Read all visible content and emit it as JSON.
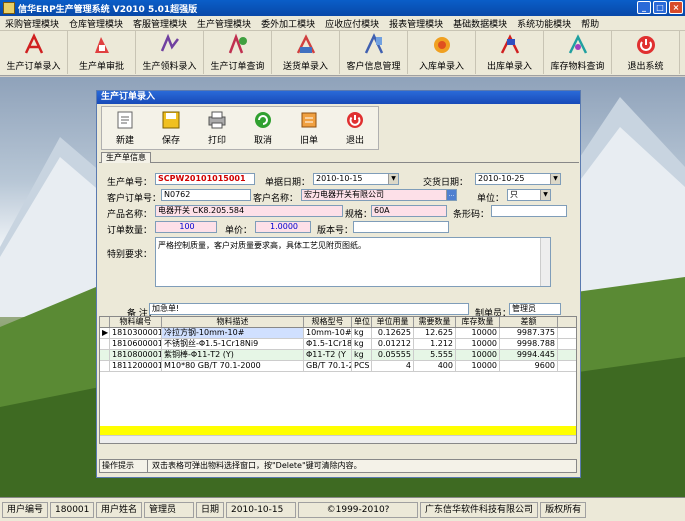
{
  "titlebar": {
    "title": "信华ERP生产管理系统  V2010 5.01超强版"
  },
  "menu": [
    "采购管理模块",
    "仓库管理模块",
    "客服管理模块",
    "生产管理模块",
    "委外加工模块",
    "应收应付模块",
    "报表管理模块",
    "基础数据模块",
    "系统功能模块",
    "帮助"
  ],
  "toolbar": [
    {
      "label": "生产订单录入",
      "icon": "adobe-red-icon"
    },
    {
      "label": "生产单审批",
      "icon": "red-doc-icon"
    },
    {
      "label": "生产领料录入",
      "icon": "material-icon"
    },
    {
      "label": "生产订单查询",
      "icon": "query-icon"
    },
    {
      "label": "送货单录入",
      "icon": "delivery-icon"
    },
    {
      "label": "客户信息管理",
      "icon": "customer-icon"
    },
    {
      "label": "入库单录入",
      "icon": "stock-in-icon"
    },
    {
      "label": "出库单录入",
      "icon": "stock-out-icon"
    },
    {
      "label": "库存物料查询",
      "icon": "inventory-icon"
    },
    {
      "label": "退出系统",
      "icon": "exit-icon"
    }
  ],
  "form": {
    "title": "生产订单录入",
    "tools": [
      {
        "label": "新建",
        "icon": "new-icon"
      },
      {
        "label": "保存",
        "icon": "save-icon"
      },
      {
        "label": "打印",
        "icon": "print-icon"
      },
      {
        "label": "取消",
        "icon": "cancel-icon"
      },
      {
        "label": "旧单",
        "icon": "old-order-icon"
      },
      {
        "label": "退出",
        "icon": "exit-icon"
      }
    ],
    "tab": "生产单信息",
    "labels": {
      "order_no": "生产单号：",
      "doc_date": "单据日期：",
      "delivery_date": "交货日期：",
      "cust_order": "客户订单号：",
      "cust_name": "客户名称：",
      "unit": "单位：",
      "product": "产品名称：",
      "spec": "规格：",
      "barcode": "条形码：",
      "qty": "订单数量：",
      "price": "单价：",
      "version": "版本号：",
      "requirement": "特别要求：",
      "note": "备 注：",
      "maker": "制单员："
    },
    "values": {
      "order_no": "SCPW20101015001",
      "doc_date": "2010-10-15",
      "delivery_date": "2010-10-25",
      "cust_order": "N0762",
      "cust_name": "宏力电器开关有限公司",
      "unit": "只",
      "product": "电器开关 CK8.205.584",
      "spec": "60A",
      "barcode": "",
      "qty": "100",
      "price": "1.0000",
      "version": "",
      "requirement": "严格控制质量，客户对质量要求高，具体工艺见附页图纸。",
      "note": "加急单!",
      "maker": "管理员"
    },
    "grid": {
      "headers": [
        "物料编号",
        "物料描述",
        "规格型号",
        "单位",
        "单位用量",
        "需要数量",
        "库存数量",
        "差额"
      ],
      "rows": [
        [
          "1810300001",
          "冷拉方钢-10mm-10#",
          "10mm-10#",
          "kg",
          "0.12625",
          "12.625",
          "10000",
          "9987.375"
        ],
        [
          "1810600001",
          "不锈钢丝-Φ1.5-1Cr18Ni9",
          "Φ1.5-1Cr18",
          "kg",
          "0.01212",
          "1.212",
          "10000",
          "9998.788"
        ],
        [
          "1810800001",
          "紫铜棒-Φ11-T2 (Y)",
          "Φ11-T2 (Y",
          "kg",
          "0.05555",
          "5.555",
          "10000",
          "9994.445"
        ],
        [
          "1811200001",
          "M10*80 GB/T 70.1-2000",
          "GB/T 70.1-2",
          "PCS",
          "4",
          "400",
          "10000",
          "9600"
        ]
      ]
    },
    "hint": {
      "label": "操作提示",
      "text": "双击表格可弹出物料选择窗口，按\"Delete\"键可清除内容。"
    }
  },
  "status": {
    "user_code_label": "用户编号",
    "user_code": "180001",
    "user_name_label": "用户姓名",
    "user_name": "管理员",
    "date_label": "日期",
    "date": "2010-10-15",
    "copyright": "©1999-2010?",
    "company": "广东信华软件科技有限公司",
    "rights": "版权所有"
  }
}
